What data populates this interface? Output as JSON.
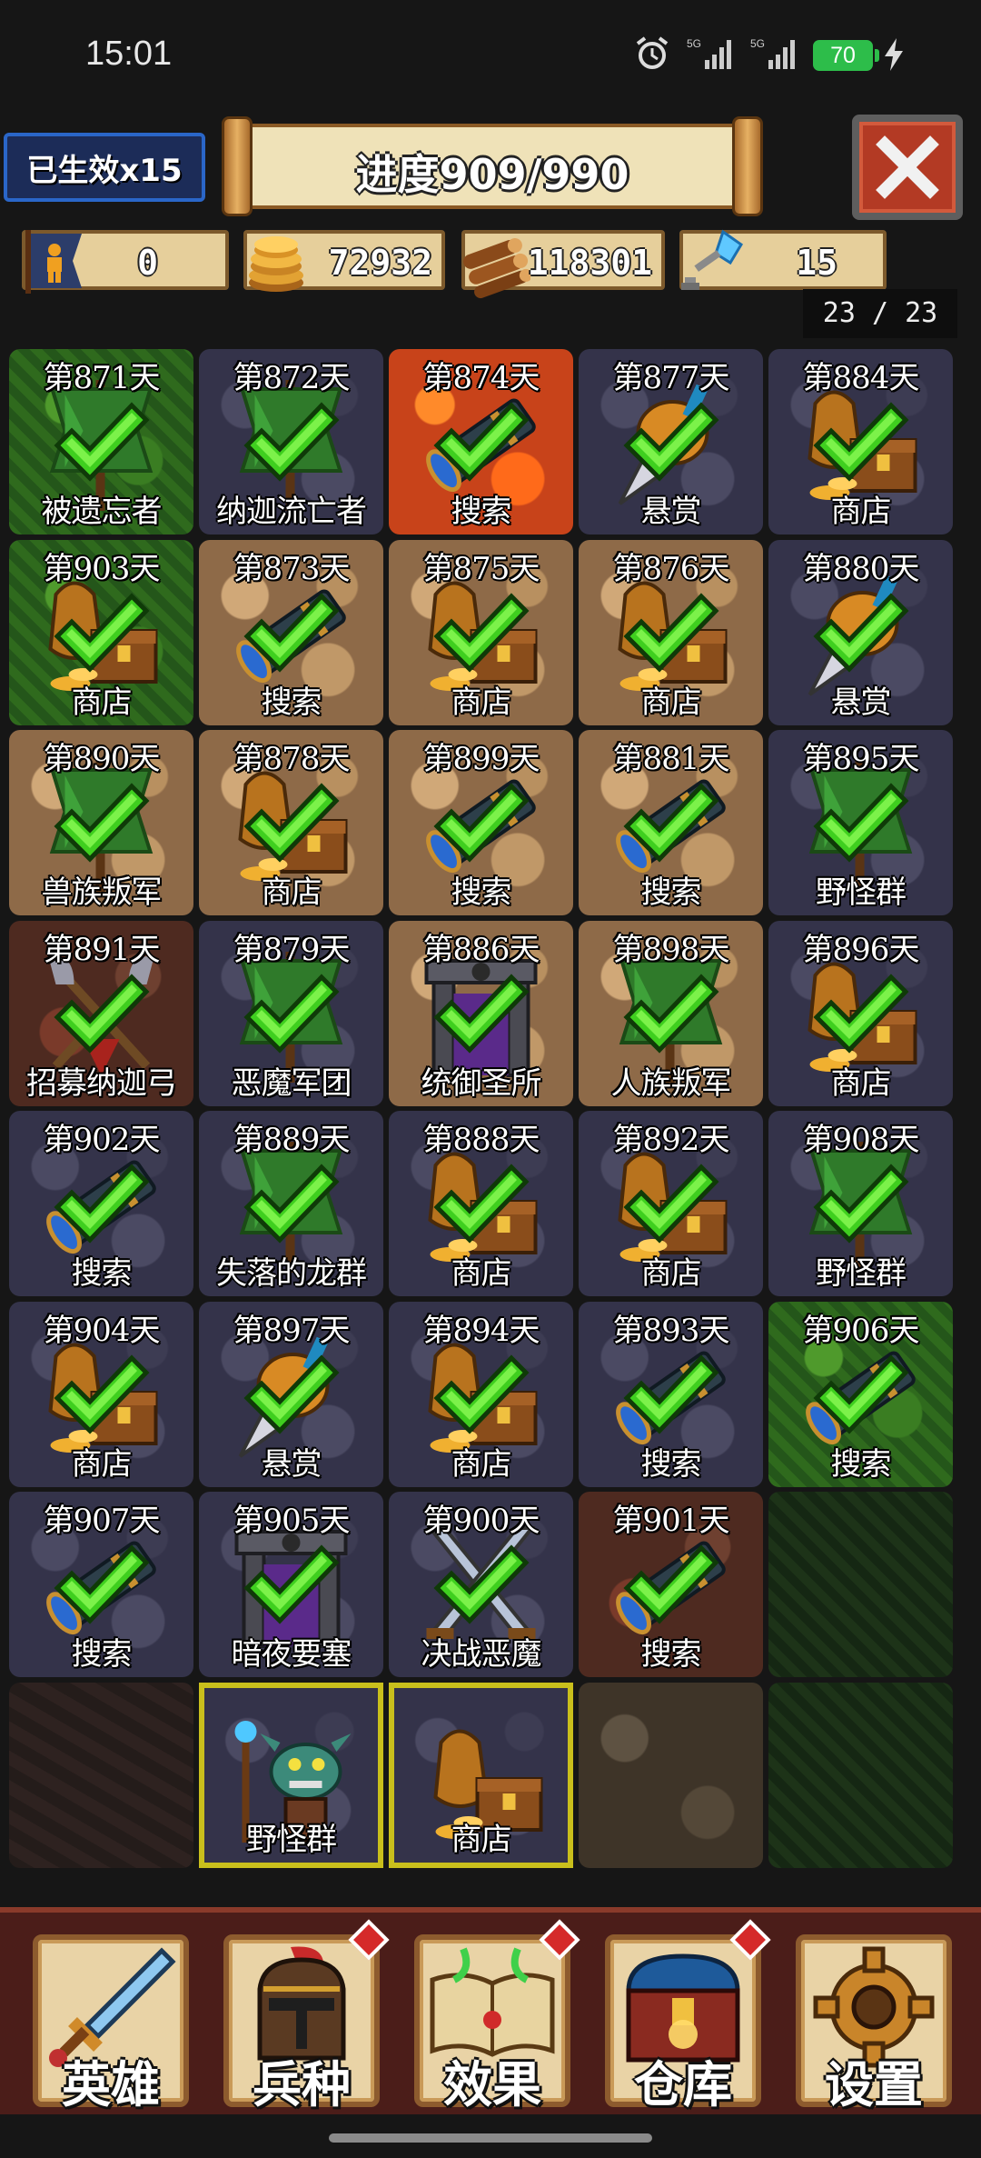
{
  "status_bar": {
    "time": "15:01",
    "battery": "70",
    "network": "5G"
  },
  "header": {
    "lives_label": "已生效x15",
    "progress_label": "进度909/990",
    "close_icon": "close-icon"
  },
  "resources": {
    "population": "0",
    "gold": "72932",
    "wood": "118301",
    "crystal": "15"
  },
  "counter": "23 / 23",
  "tiles": [
    {
      "day": "第871天",
      "name": "被遗忘者",
      "bg": "forest",
      "icon": "banner",
      "done": true
    },
    {
      "day": "第872天",
      "name": "纳迦流亡者",
      "bg": "stone",
      "icon": "banner",
      "done": true
    },
    {
      "day": "第874天",
      "name": "搜索",
      "bg": "lava",
      "icon": "spyglass",
      "done": true
    },
    {
      "day": "第877天",
      "name": "悬赏",
      "bg": "stone",
      "icon": "dagger",
      "done": true
    },
    {
      "day": "第884天",
      "name": "商店",
      "bg": "stone",
      "icon": "treasure",
      "done": true
    },
    {
      "day": "第903天",
      "name": "商店",
      "bg": "forest",
      "icon": "treasure",
      "done": true
    },
    {
      "day": "第873天",
      "name": "搜索",
      "bg": "cobble",
      "icon": "spyglass",
      "done": true
    },
    {
      "day": "第875天",
      "name": "商店",
      "bg": "cobble",
      "icon": "treasure",
      "done": true
    },
    {
      "day": "第876天",
      "name": "商店",
      "bg": "cobble",
      "icon": "treasure",
      "done": true
    },
    {
      "day": "第880天",
      "name": "悬赏",
      "bg": "stone",
      "icon": "dagger",
      "done": true
    },
    {
      "day": "第890天",
      "name": "兽族叛军",
      "bg": "cobble",
      "icon": "banner",
      "done": true
    },
    {
      "day": "第878天",
      "name": "商店",
      "bg": "cobble",
      "icon": "treasure",
      "done": true
    },
    {
      "day": "第899天",
      "name": "搜索",
      "bg": "cobble",
      "icon": "spyglass",
      "done": true
    },
    {
      "day": "第881天",
      "name": "搜索",
      "bg": "cobble",
      "icon": "spyglass",
      "done": true
    },
    {
      "day": "第895天",
      "name": "野怪群",
      "bg": "stone",
      "icon": "banner",
      "done": true
    },
    {
      "day": "第891天",
      "name": "招募纳迦弓",
      "bg": "dirt",
      "icon": "axes",
      "done": true
    },
    {
      "day": "第879天",
      "name": "恶魔军团",
      "bg": "stone",
      "icon": "banner",
      "done": true
    },
    {
      "day": "第886天",
      "name": "统御圣所",
      "bg": "cobble",
      "icon": "shrine",
      "done": true
    },
    {
      "day": "第898天",
      "name": "人族叛军",
      "bg": "cobble",
      "icon": "banner",
      "done": true
    },
    {
      "day": "第896天",
      "name": "商店",
      "bg": "stone",
      "icon": "treasure",
      "done": true
    },
    {
      "day": "第902天",
      "name": "搜索",
      "bg": "stone",
      "icon": "spyglass",
      "done": true
    },
    {
      "day": "第889天",
      "name": "失落的龙群",
      "bg": "stone",
      "icon": "banner",
      "done": true
    },
    {
      "day": "第888天",
      "name": "商店",
      "bg": "stone",
      "icon": "treasure",
      "done": true
    },
    {
      "day": "第892天",
      "name": "商店",
      "bg": "stone",
      "icon": "treasure",
      "done": true
    },
    {
      "day": "第908天",
      "name": "野怪群",
      "bg": "stone",
      "icon": "banner",
      "done": true
    },
    {
      "day": "第904天",
      "name": "商店",
      "bg": "stone",
      "icon": "treasure",
      "done": true
    },
    {
      "day": "第897天",
      "name": "悬赏",
      "bg": "stone",
      "icon": "dagger",
      "done": true
    },
    {
      "day": "第894天",
      "name": "商店",
      "bg": "stone",
      "icon": "treasure",
      "done": true
    },
    {
      "day": "第893天",
      "name": "搜索",
      "bg": "stone",
      "icon": "spyglass",
      "done": true
    },
    {
      "day": "第906天",
      "name": "搜索",
      "bg": "forest",
      "icon": "spyglass",
      "done": true
    },
    {
      "day": "第907天",
      "name": "搜索",
      "bg": "stone",
      "icon": "spyglass",
      "done": true
    },
    {
      "day": "第905天",
      "name": "暗夜要塞",
      "bg": "stone",
      "icon": "shrine",
      "done": true
    },
    {
      "day": "第900天",
      "name": "决战恶魔",
      "bg": "stone",
      "icon": "swords",
      "done": true
    },
    {
      "day": "第901天",
      "name": "搜索",
      "bg": "dirt",
      "icon": "spyglass",
      "done": true
    },
    {
      "day": "",
      "name": "",
      "bg": "darkforest",
      "icon": "",
      "done": false
    },
    {
      "day": "",
      "name": "",
      "bg": "lavadark",
      "icon": "",
      "done": false
    },
    {
      "day": "",
      "name": "野怪群",
      "bg": "stone",
      "icon": "murloc",
      "done": false,
      "selected": true
    },
    {
      "day": "",
      "name": "商店",
      "bg": "stone",
      "icon": "treasure",
      "done": false,
      "selected": true
    },
    {
      "day": "",
      "name": "",
      "bg": "cobbledark",
      "icon": "",
      "done": false
    },
    {
      "day": "",
      "name": "",
      "bg": "darkforest",
      "icon": "",
      "done": false
    }
  ],
  "nav": [
    {
      "label": "英雄",
      "icon": "sword-icon",
      "badge": false
    },
    {
      "label": "兵种",
      "icon": "helmet-icon",
      "badge": true
    },
    {
      "label": "效果",
      "icon": "spellbook-icon",
      "badge": true
    },
    {
      "label": "仓库",
      "icon": "chest-icon",
      "badge": true
    },
    {
      "label": "设置",
      "icon": "gear-icon",
      "badge": false
    }
  ],
  "colors": {
    "background": "#161616",
    "check": "#3fcf1f",
    "selected_border": "#c9bf1c",
    "badge": "#d52a2a",
    "nav_bar": "#4b1d19"
  }
}
